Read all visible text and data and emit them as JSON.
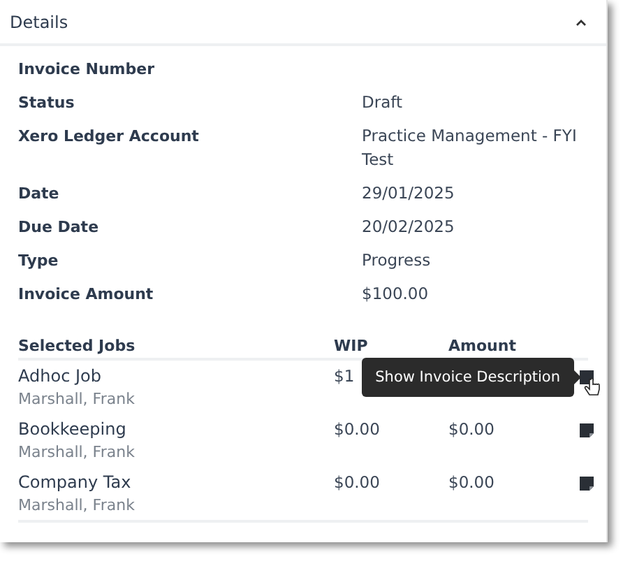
{
  "panel": {
    "title": "Details",
    "expanded": true
  },
  "fields": [
    {
      "label": "Invoice Number"
    },
    {
      "label": "Status",
      "value": "Draft"
    },
    {
      "label": "Xero Ledger Account",
      "value": "Practice Management - FYI Test"
    },
    {
      "label": "Date",
      "value": "29/01/2025"
    },
    {
      "label": "Due Date",
      "value": "20/02/2025"
    },
    {
      "label": "Type",
      "value": "Progress"
    },
    {
      "label": "Invoice Amount",
      "value": "$100.00"
    }
  ],
  "jobs_table": {
    "columns": [
      "Selected Jobs",
      "WIP",
      "Amount"
    ],
    "rows": [
      {
        "job": "Adhoc Job",
        "person": "Marshall, Frank",
        "wip": "$1",
        "tooltip": "Show Invoice Description"
      },
      {
        "job": "Bookkeeping",
        "person": "Marshall, Frank",
        "wip": "$0.00",
        "amount": "$0.00"
      },
      {
        "job": "Company Tax",
        "person": "Marshall, Frank",
        "wip": "$0.00",
        "amount": "$0.00"
      }
    ]
  }
}
